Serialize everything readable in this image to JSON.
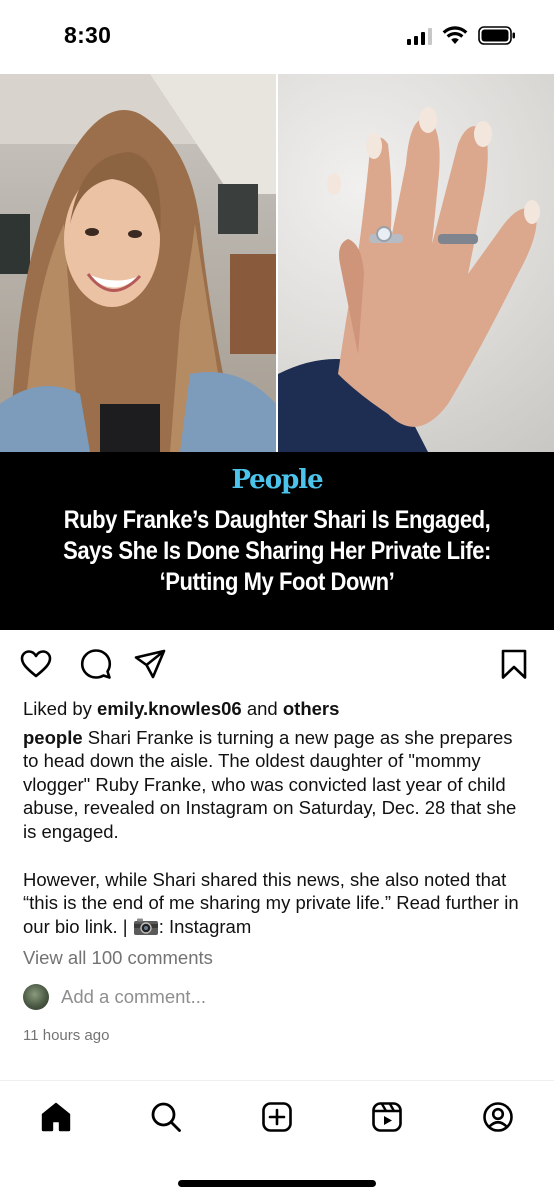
{
  "status_bar": {
    "time": "8:30"
  },
  "post": {
    "publisher_logo": "People",
    "headline": "Ruby Franke’s Daughter Shari Is Engaged, Says She Is Done Sharing Her Private Life: ‘Putting My Foot Down’",
    "likes": {
      "prefix": "Liked by",
      "user": "emily.knowles06",
      "middle": "and",
      "suffix": "others"
    },
    "caption": {
      "author": "people",
      "paragraph1": "Shari Franke is turning a new page as she prepares to head down the aisle. The oldest daughter of \"mommy vlogger\" Ruby Franke, who was convicted last year of child abuse, revealed on Instagram on Saturday, Dec. 28 that she is engaged.",
      "paragraph2_before_icon": "However, while Shari shared this news, she also noted that “this is the end of me sharing my private life.” Read further in our bio link. |",
      "paragraph2_after_icon": ": Instagram"
    },
    "view_all_comments": "View all 100 comments",
    "add_comment_placeholder": "Add a comment...",
    "timestamp": "11 hours ago"
  },
  "icons": {
    "actions": [
      "heart-icon",
      "comment-icon",
      "share-icon",
      "bookmark-icon"
    ],
    "nav": [
      "home-icon",
      "search-icon",
      "create-icon",
      "reels-icon",
      "profile-icon"
    ]
  },
  "colors": {
    "brand_people": "#4cc3ea",
    "banner_bg": "#000000",
    "muted_text": "#737373"
  }
}
